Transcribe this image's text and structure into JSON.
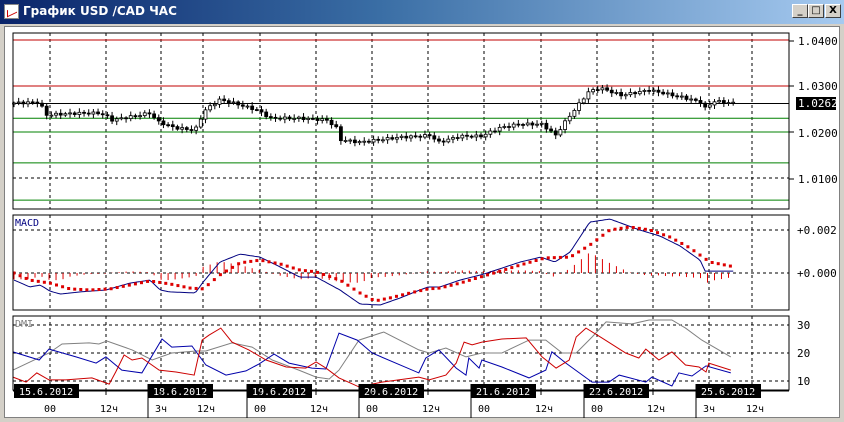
{
  "window": {
    "title": "График USD /CAD  ЧАС",
    "buttons": {
      "minimize": "_",
      "maximize": "□",
      "close": "X"
    }
  },
  "colors": {
    "candle": "#000000",
    "resistance": "#c00000",
    "support": "#008000",
    "macd": "#000080",
    "signal": "#dd0000",
    "adx": "#808080",
    "plus_di": "#0000aa",
    "minus_di": "#cc0000"
  },
  "chart_data": [
    {
      "type": "candlestick",
      "title": "USD/CAD H1",
      "ylim": [
        1.003,
        1.0418
      ],
      "y_ticks": [
        "1.0400",
        "1.0300",
        "1.0200",
        "1.0100"
      ],
      "current_price": "1.0262",
      "levels": [
        {
          "price": 1.04,
          "color": "red"
        },
        {
          "price": 1.03,
          "color": "red"
        },
        {
          "price": 1.0262,
          "color": "black"
        },
        {
          "price": 1.023,
          "color": "green"
        },
        {
          "price": 1.02,
          "color": "green"
        },
        {
          "price": 1.0133,
          "color": "green"
        },
        {
          "price": 1.0052,
          "color": "green"
        }
      ],
      "close_path": [
        [
          0,
          1.0263
        ],
        [
          5.6,
          1.0265
        ],
        [
          6.6,
          1.0237
        ],
        [
          14,
          1.0241
        ],
        [
          18.4,
          1.0241
        ],
        [
          19.7,
          1.0235
        ],
        [
          21,
          1.0226
        ],
        [
          29,
          1.0241
        ],
        [
          31,
          1.0222
        ],
        [
          34.5,
          1.0209
        ],
        [
          38.8,
          1.0204
        ],
        [
          40,
          1.023
        ],
        [
          41,
          1.0248
        ],
        [
          44,
          1.027
        ],
        [
          47,
          1.0263
        ],
        [
          52,
          1.0248
        ],
        [
          55,
          1.023
        ],
        [
          61,
          1.023
        ],
        [
          67,
          1.0226
        ],
        [
          69,
          1.0209
        ],
        [
          70,
          1.0183
        ],
        [
          74,
          1.0178
        ],
        [
          78,
          1.0183
        ],
        [
          83,
          1.0189
        ],
        [
          87,
          1.0191
        ],
        [
          89,
          1.0193
        ],
        [
          91,
          1.0178
        ],
        [
          95.5,
          1.0191
        ],
        [
          100,
          1.0191
        ],
        [
          104,
          1.0209
        ],
        [
          108,
          1.0217
        ],
        [
          113,
          1.0217
        ],
        [
          116,
          1.0193
        ],
        [
          118,
          1.0222
        ],
        [
          120,
          1.0248
        ],
        [
          123,
          1.0287
        ],
        [
          125.5,
          1.0296
        ],
        [
          130,
          1.028
        ],
        [
          136,
          1.0291
        ],
        [
          143,
          1.0276
        ],
        [
          147,
          1.0265
        ],
        [
          148,
          1.0252
        ],
        [
          150,
          1.0267
        ],
        [
          154,
          1.0263
        ]
      ],
      "bars": 155
    },
    {
      "type": "line",
      "title": "MACD",
      "y_ticks": [
        "+0.002",
        "+0.000"
      ],
      "units": 0.001,
      "macd": [
        [
          0,
          -0.33
        ],
        [
          3.4,
          -0.65
        ],
        [
          5.6,
          -0.56
        ],
        [
          7.7,
          -0.84
        ],
        [
          9.9,
          -0.98
        ],
        [
          14.1,
          -0.88
        ],
        [
          19.7,
          -0.79
        ],
        [
          24.8,
          -0.47
        ],
        [
          29.1,
          -0.33
        ],
        [
          31.3,
          -0.79
        ],
        [
          33.4,
          -0.88
        ],
        [
          38.8,
          -0.93
        ],
        [
          40.5,
          -0.42
        ],
        [
          44.1,
          0.51
        ],
        [
          48.4,
          0.88
        ],
        [
          52.7,
          0.74
        ],
        [
          57,
          0.28
        ],
        [
          61.2,
          -0.19
        ],
        [
          64.7,
          -0.19
        ],
        [
          69.8,
          -0.79
        ],
        [
          74.1,
          -1.44
        ],
        [
          78.4,
          -1.49
        ],
        [
          82.7,
          -1.16
        ],
        [
          86.9,
          -0.79
        ],
        [
          88.7,
          -0.65
        ],
        [
          91.2,
          -0.65
        ],
        [
          95.5,
          -0.33
        ],
        [
          100.6,
          -0.05
        ],
        [
          108.4,
          0.51
        ],
        [
          112.8,
          0.74
        ],
        [
          115.8,
          0.51
        ],
        [
          119.1,
          0.98
        ],
        [
          123.3,
          2.37
        ],
        [
          127.6,
          2.51
        ],
        [
          134,
          2.0
        ],
        [
          138.3,
          1.72
        ],
        [
          142.6,
          1.26
        ],
        [
          146.9,
          0.6
        ],
        [
          148,
          0.09
        ],
        [
          151.2,
          0.09
        ],
        [
          154.4,
          0.09
        ]
      ],
      "signal": [
        [
          0,
          0
        ],
        [
          3.4,
          -0.33
        ],
        [
          7.7,
          -0.47
        ],
        [
          12,
          -0.74
        ],
        [
          16.3,
          -0.79
        ],
        [
          20.6,
          -0.74
        ],
        [
          24.8,
          -0.56
        ],
        [
          29.1,
          -0.37
        ],
        [
          33.4,
          -0.51
        ],
        [
          37.7,
          -0.7
        ],
        [
          40.5,
          -0.74
        ],
        [
          44.1,
          -0.09
        ],
        [
          48.4,
          0.47
        ],
        [
          52.7,
          0.6
        ],
        [
          57,
          0.42
        ],
        [
          61.2,
          0.14
        ],
        [
          64.7,
          0.05
        ],
        [
          69.8,
          -0.33
        ],
        [
          74.1,
          -0.93
        ],
        [
          77.3,
          -1.3
        ],
        [
          80.5,
          -1.16
        ],
        [
          84.8,
          -0.93
        ],
        [
          88.7,
          -0.74
        ],
        [
          91.2,
          -0.7
        ],
        [
          95.5,
          -0.47
        ],
        [
          100.6,
          -0.14
        ],
        [
          108.4,
          0.37
        ],
        [
          113.7,
          0.7
        ],
        [
          119.1,
          0.74
        ],
        [
          123.3,
          1.3
        ],
        [
          127.6,
          2.0
        ],
        [
          131.9,
          2.14
        ],
        [
          136.2,
          2.0
        ],
        [
          140.5,
          1.67
        ],
        [
          144.8,
          1.16
        ],
        [
          149,
          0.51
        ],
        [
          154.4,
          0.28
        ]
      ]
    },
    {
      "type": "line",
      "title": "DMI",
      "y_ticks": [
        "30",
        "20",
        "10"
      ],
      "adx": [
        [
          0,
          13.9
        ],
        [
          7.7,
          20
        ],
        [
          10.5,
          23.2
        ],
        [
          16.3,
          23.6
        ],
        [
          18.4,
          23.2
        ],
        [
          20.1,
          24.3
        ],
        [
          25.5,
          21.1
        ],
        [
          29.8,
          17.5
        ],
        [
          34,
          20
        ],
        [
          39.2,
          20.7
        ],
        [
          41.3,
          20.7
        ],
        [
          46.9,
          23.6
        ],
        [
          51.2,
          22.1
        ],
        [
          55.5,
          17.5
        ],
        [
          61.2,
          13.9
        ],
        [
          64.9,
          11.4
        ],
        [
          67.7,
          10.7
        ],
        [
          69.8,
          13.9
        ],
        [
          74.1,
          24.6
        ],
        [
          79.4,
          27.5
        ],
        [
          86.9,
          21.1
        ],
        [
          89.1,
          20
        ],
        [
          92.7,
          21.8
        ],
        [
          97,
          18.6
        ],
        [
          100.4,
          20
        ],
        [
          104.7,
          20
        ],
        [
          110.5,
          24.6
        ],
        [
          114.1,
          24.6
        ],
        [
          117.6,
          20
        ],
        [
          120.6,
          20
        ],
        [
          124,
          25.7
        ],
        [
          127,
          31.1
        ],
        [
          132.5,
          30.4
        ],
        [
          136.2,
          31.8
        ],
        [
          141.1,
          31.8
        ],
        [
          144,
          28.9
        ],
        [
          147.5,
          24.6
        ],
        [
          153.7,
          18.6
        ]
      ],
      "plus_di": [
        [
          0,
          20.4
        ],
        [
          5.6,
          17.5
        ],
        [
          7.7,
          21.4
        ],
        [
          13.5,
          18.6
        ],
        [
          17.8,
          16.4
        ],
        [
          19.9,
          18.6
        ],
        [
          23.3,
          13.9
        ],
        [
          27.6,
          12.9
        ],
        [
          31.9,
          25
        ],
        [
          34,
          22.1
        ],
        [
          38.3,
          22.5
        ],
        [
          41.3,
          15.7
        ],
        [
          45.6,
          12.1
        ],
        [
          49.9,
          13.6
        ],
        [
          52.7,
          16.1
        ],
        [
          55.9,
          19.6
        ],
        [
          59.1,
          16.4
        ],
        [
          64,
          14.6
        ],
        [
          67,
          14.3
        ],
        [
          69.8,
          27.1
        ],
        [
          73.7,
          24.6
        ],
        [
          76.9,
          20
        ],
        [
          86.9,
          12.9
        ],
        [
          88.4,
          18.2
        ],
        [
          91.2,
          21.1
        ],
        [
          94.9,
          14.6
        ],
        [
          97,
          12.1
        ],
        [
          97.6,
          18.2
        ],
        [
          99.8,
          14.6
        ],
        [
          100.4,
          17.5
        ],
        [
          104.7,
          15
        ],
        [
          110.5,
          11.1
        ],
        [
          114.1,
          13.9
        ],
        [
          115.4,
          20.4
        ],
        [
          118.4,
          16.4
        ],
        [
          124,
          9.6
        ],
        [
          127.6,
          9.6
        ],
        [
          129.8,
          12.1
        ],
        [
          135.5,
          9.6
        ],
        [
          136.8,
          11.4
        ],
        [
          141.1,
          8.2
        ],
        [
          142.6,
          12.9
        ],
        [
          145.4,
          11.8
        ],
        [
          148.4,
          15.4
        ],
        [
          153.7,
          12.9
        ]
      ],
      "minus_di": [
        [
          0,
          11.4
        ],
        [
          2.8,
          9.6
        ],
        [
          5.1,
          12.9
        ],
        [
          7.7,
          10.4
        ],
        [
          11.3,
          10.4
        ],
        [
          16.9,
          11.1
        ],
        [
          20.6,
          8.9
        ],
        [
          22,
          13.2
        ],
        [
          23.8,
          19.3
        ],
        [
          25.5,
          17.5
        ],
        [
          27.6,
          18.2
        ],
        [
          31.3,
          13.9
        ],
        [
          34.9,
          13.2
        ],
        [
          38.8,
          12.1
        ],
        [
          40.5,
          24.6
        ],
        [
          42,
          26.4
        ],
        [
          44.5,
          28.9
        ],
        [
          46.9,
          23.9
        ],
        [
          50.5,
          21.1
        ],
        [
          54.2,
          17.5
        ],
        [
          58.5,
          15
        ],
        [
          62.7,
          14.6
        ],
        [
          64.9,
          16.8
        ],
        [
          67,
          14.6
        ],
        [
          69.8,
          11.1
        ],
        [
          74.1,
          7.9
        ],
        [
          79,
          9.6
        ],
        [
          86.9,
          11.4
        ],
        [
          89.1,
          10.4
        ],
        [
          92.7,
          12.1
        ],
        [
          94.9,
          16.4
        ],
        [
          96.6,
          23.9
        ],
        [
          98.3,
          22.9
        ],
        [
          100.4,
          23.9
        ],
        [
          104.7,
          25
        ],
        [
          109.9,
          25.4
        ],
        [
          113.3,
          18.6
        ],
        [
          116.3,
          14.6
        ],
        [
          119.1,
          17.5
        ],
        [
          120.6,
          25.7
        ],
        [
          122.7,
          28.9
        ],
        [
          126.1,
          25.4
        ],
        [
          131.2,
          20
        ],
        [
          134,
          18.2
        ],
        [
          135.5,
          21.4
        ],
        [
          138.3,
          17.5
        ],
        [
          141.1,
          20.4
        ],
        [
          144,
          15.7
        ],
        [
          146.9,
          15
        ],
        [
          148.4,
          13.2
        ],
        [
          149,
          16.4
        ],
        [
          153.7,
          13.9
        ]
      ]
    }
  ],
  "time_axis": {
    "dates": [
      "15.6.2012",
      "18.6.2012",
      "19.6.2012",
      "20.6.2012",
      "21.6.2012",
      "22.6.2012",
      "25.6.2012"
    ],
    "hours": [
      "00",
      "12ч",
      "3ч",
      "12ч",
      "00",
      "12ч",
      "00",
      "12ч",
      "00",
      "12ч",
      "00",
      "12ч",
      "3ч",
      "12ч"
    ]
  }
}
